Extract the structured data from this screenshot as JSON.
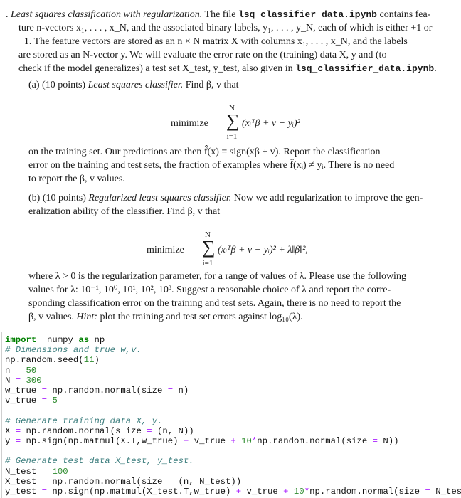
{
  "intro": {
    "bullet": ".",
    "title": "Least squares classification with regularization.",
    "l1a": " The file ",
    "file": "lsq_classifier_data.ipynb",
    "l1b": " contains fea-",
    "l2": "ture n-vectors x₁, . . . , x_N, and the associated binary labels, y₁, . . . , y_N, each of which is either +1 or",
    "l3": "−1. The feature vectors are stored as an n × N matrix X with columns x₁, . . . , x_N, and the labels",
    "l4": "are stored as an N-vector y. We will evaluate the error rate on the (training) data X, y and (to",
    "l5a": "check if the model generalizes) a test set X_test, y_test, also given in ",
    "l5b": "."
  },
  "part_a": {
    "label": "(a) (10 points) ",
    "title": "Least squares classifier.",
    "text": " Find β, v that",
    "minimize": "minimize",
    "sum_top": "N",
    "sum_bottom": "i=1",
    "objective": "(xᵢᵀβ + v − yᵢ)²",
    "l1": "on the training set. Our predictions are then f̂(x) = sign(xβ + v). Report the classification",
    "l2": "error on the training and test sets, the fraction of examples where f̂(xᵢ) ≠ yᵢ. There is no need",
    "l3": "to report the β, v values."
  },
  "part_b": {
    "label": "(b) (10 points) ",
    "title": "Regularized least squares classifier.",
    "text": " Now we add regularization to improve the gen-",
    "l2": "eralization ability of the classifier. Find β, v that",
    "minimize": "minimize",
    "sum_top": "N",
    "sum_bottom": "i=1",
    "objective": "(xᵢᵀβ + v − yᵢ)² + λ‖β‖²,",
    "l3": "where λ > 0 is the regularization parameter, for a range of values of λ. Please use the following",
    "l4": "values for λ: 10⁻¹, 10⁰, 10¹, 10², 10³. Suggest a reasonable choice of λ and report the corre-",
    "l5": "sponding classification error on the training and test sets. Again, there is no need to report the",
    "l6a": "β, v values. ",
    "hint": "Hint:",
    "l6b": " plot the training and test set errors against log₁₀(λ)."
  },
  "code": [
    [
      [
        "kw",
        "import"
      ],
      [
        "",
        "  numpy "
      ],
      [
        "kw",
        "as"
      ],
      [
        "",
        " np"
      ]
    ],
    [
      [
        "cm",
        "# Dimensions and true w,v."
      ]
    ],
    [
      [
        "",
        "np.random.seed("
      ],
      [
        "nu",
        "11"
      ],
      [
        "",
        ")"
      ]
    ],
    [
      [
        "",
        "n "
      ],
      [
        "eq",
        "="
      ],
      [
        "",
        " "
      ],
      [
        "nu",
        "50"
      ]
    ],
    [
      [
        "",
        "N "
      ],
      [
        "eq",
        "="
      ],
      [
        "",
        " "
      ],
      [
        "nu",
        "300"
      ]
    ],
    [
      [
        "",
        "w_true "
      ],
      [
        "eq",
        "="
      ],
      [
        "",
        " np.random.normal(size "
      ],
      [
        "eq",
        "="
      ],
      [
        "",
        " n)"
      ]
    ],
    [
      [
        "",
        "v_true "
      ],
      [
        "eq",
        "="
      ],
      [
        "",
        " "
      ],
      [
        "nu",
        "5"
      ]
    ],
    [],
    [
      [
        "cm",
        "# Generate training data X, y."
      ]
    ],
    [
      [
        "",
        "X "
      ],
      [
        "eq",
        "="
      ],
      [
        "",
        " np.random.normal(s ize "
      ],
      [
        "eq",
        "="
      ],
      [
        "",
        " (n, N))"
      ]
    ],
    [
      [
        "",
        "y "
      ],
      [
        "eq",
        "="
      ],
      [
        "",
        " np.sign(np.matmul(X.T,w_true) "
      ],
      [
        "eq",
        "+"
      ],
      [
        "",
        " v_true "
      ],
      [
        "eq",
        "+"
      ],
      [
        "",
        " "
      ],
      [
        "nu",
        "10"
      ],
      [
        "eq",
        "*"
      ],
      [
        "",
        "np.random.normal(size "
      ],
      [
        "eq",
        "="
      ],
      [
        "",
        " N))"
      ]
    ],
    [],
    [
      [
        "cm",
        "# Generate test data X_test, y_test."
      ]
    ],
    [
      [
        "",
        "N_test "
      ],
      [
        "eq",
        "="
      ],
      [
        "",
        " "
      ],
      [
        "nu",
        "100"
      ]
    ],
    [
      [
        "",
        "X_test "
      ],
      [
        "eq",
        "="
      ],
      [
        "",
        " np.random.normal(size "
      ],
      [
        "eq",
        "="
      ],
      [
        "",
        " (n, N_test))"
      ]
    ],
    [
      [
        "",
        "y_test "
      ],
      [
        "eq",
        "="
      ],
      [
        "",
        " np.sign(np.matmul(X_test.T,w_true) "
      ],
      [
        "eq",
        "+"
      ],
      [
        "",
        " v_true "
      ],
      [
        "eq",
        "+"
      ],
      [
        "",
        " "
      ],
      [
        "nu",
        "10"
      ],
      [
        "eq",
        "*"
      ],
      [
        "",
        "np.random.normal(size "
      ],
      [
        "eq",
        "="
      ],
      [
        "",
        " N_test))"
      ]
    ]
  ]
}
